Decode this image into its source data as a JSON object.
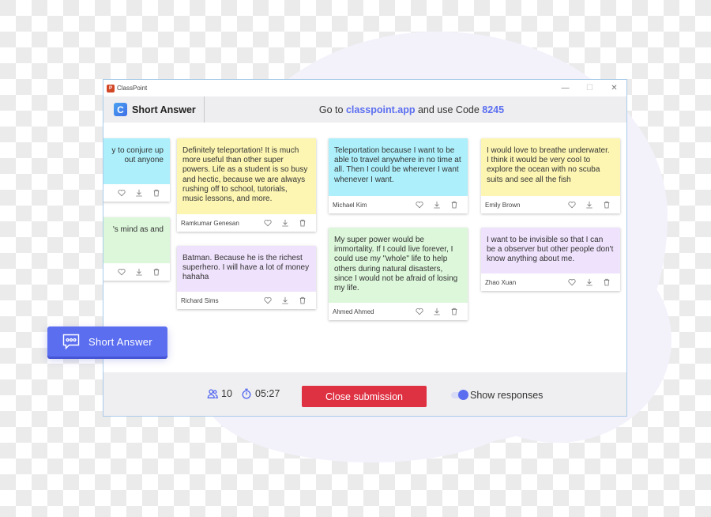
{
  "app": {
    "window_title": "ClassPoint",
    "logo_letter": "P"
  },
  "window_controls": {
    "minimize": "—",
    "maximize": "☐",
    "close": "✕"
  },
  "header": {
    "logo_letter": "C",
    "title": "Short Answer",
    "instruction_prefix": "Go to ",
    "url": "classpoint.app",
    "instruction_middle": " and use Code ",
    "code": "8245"
  },
  "colors": {
    "accent": "#5b6ef0",
    "close_button": "#de3142",
    "card_blue": "#adf0fb",
    "card_yellow": "#fdf6b3",
    "card_green": "#dcf7da",
    "card_purple": "#efe2fc"
  },
  "cards": [
    {
      "text": "y to conjure up\nout anyone",
      "author": "",
      "color": "blue",
      "partial": true
    },
    {
      "text": "'s mind as and",
      "author": "",
      "color": "green",
      "partial": true
    },
    {
      "text": "Definitely teleportation! It is much more useful than other super powers. Life as a student is so busy and hectic, because we are always rushing off to school, tutorials, music lessons, and more.",
      "author": "Ramkumar Genesan",
      "color": "yellow"
    },
    {
      "text": "Batman. Because he is the richest superhero. I will have a lot of money hahaha",
      "author": "Richard Sims",
      "color": "purple"
    },
    {
      "text": "Teleportation because I want to be able to travel anywhere in no time at all. Then I could be wherever I want whenever I want.",
      "author": "Michael Kim",
      "color": "blue"
    },
    {
      "text": "My super power would be immortality. If I could live forever, I could use my \"whole\" life to help others during natural disasters, since I would not be afraid of losing my life.",
      "author": "Ahmed Ahmed",
      "color": "green"
    },
    {
      "text": "I would love to breathe underwater. I think it would be very cool to explore the ocean with no scuba suits and see all the fish",
      "author": "Emily Brown",
      "color": "yellow"
    },
    {
      "text": "I want to be invisible so that I can be a observer but other people don't know anything about me.",
      "author": "Zhao Xuan",
      "color": "purple"
    }
  ],
  "card_actions": [
    "heart-icon",
    "download-icon",
    "trash-icon"
  ],
  "footer": {
    "participants": "10",
    "timer": "05:27",
    "close_label": "Close submission",
    "toggle_label": "Show responses",
    "toggle_on": true
  },
  "badge": {
    "label": "Short Answer",
    "icon": "speech-bubble-icon"
  }
}
